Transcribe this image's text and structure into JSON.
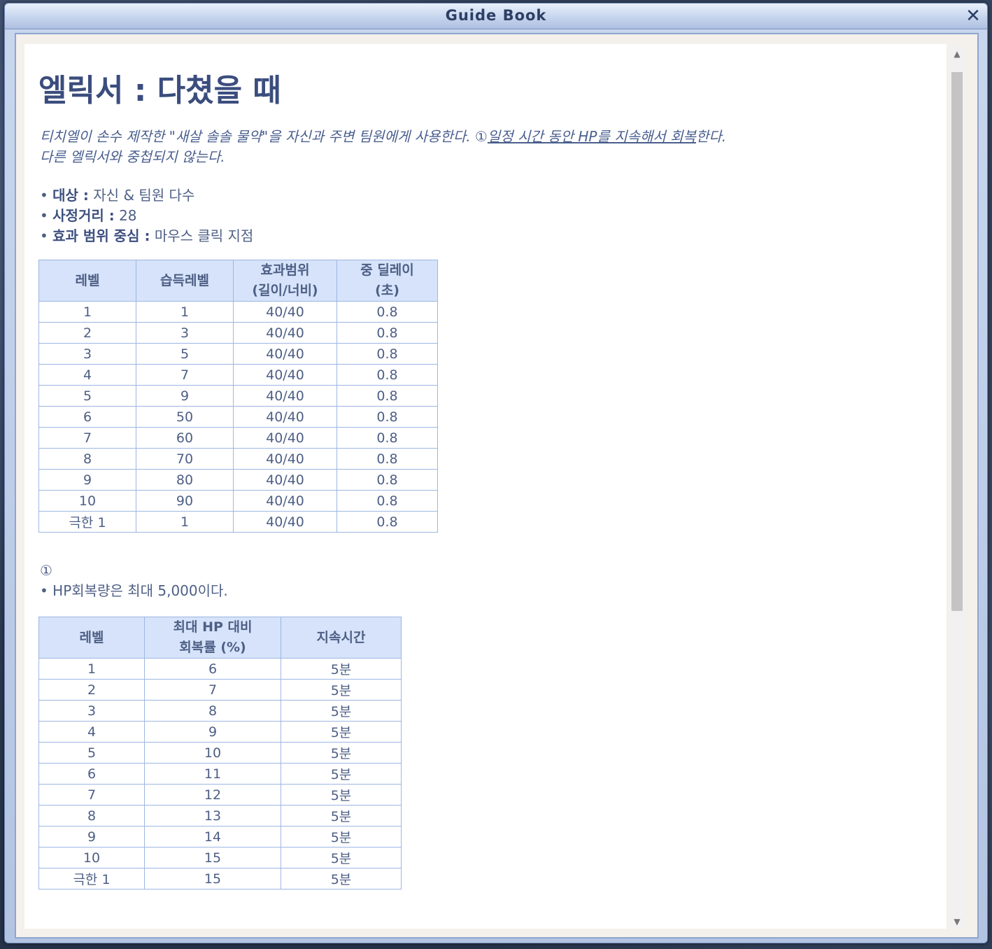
{
  "window": {
    "title": "Guide Book",
    "close_glyph": "✕"
  },
  "skill": {
    "title": "엘릭서 : 다쳤을 때",
    "description_part1": "티치엘이 손수 제작한 \"새살 솔솔 물약\"을 자신과 주변 팀원에게 사용한다. ①",
    "description_underline": "일정 시간 동안 HP를 지속해서 회복",
    "description_part2": "한다.",
    "description_line2": "다른 엘릭서와 중첩되지 않는다.",
    "specs": [
      {
        "label": "대상 :",
        "value": "자신 & 팀원 다수"
      },
      {
        "label": "사정거리 :",
        "value": "28"
      },
      {
        "label": "효과 범위 중심 :",
        "value": "마우스 클릭 지점"
      }
    ]
  },
  "table1": {
    "headers": [
      "레벨",
      "습득레벨",
      "효과범위\n(길이/너비)",
      "중 딜레이\n(초)"
    ],
    "rows": [
      [
        "1",
        "1",
        "40/40",
        "0.8"
      ],
      [
        "2",
        "3",
        "40/40",
        "0.8"
      ],
      [
        "3",
        "5",
        "40/40",
        "0.8"
      ],
      [
        "4",
        "7",
        "40/40",
        "0.8"
      ],
      [
        "5",
        "9",
        "40/40",
        "0.8"
      ],
      [
        "6",
        "50",
        "40/40",
        "0.8"
      ],
      [
        "7",
        "60",
        "40/40",
        "0.8"
      ],
      [
        "8",
        "70",
        "40/40",
        "0.8"
      ],
      [
        "9",
        "80",
        "40/40",
        "0.8"
      ],
      [
        "10",
        "90",
        "40/40",
        "0.8"
      ],
      [
        "극한 1",
        "1",
        "40/40",
        "0.8"
      ]
    ]
  },
  "note": {
    "marker": "①",
    "text": "• HP회복량은 최대 5,000이다."
  },
  "table2": {
    "headers": [
      "레벨",
      "최대 HP 대비\n회복률 (%)",
      "지속시간"
    ],
    "rows": [
      [
        "1",
        "6",
        "5분"
      ],
      [
        "2",
        "7",
        "5분"
      ],
      [
        "3",
        "8",
        "5분"
      ],
      [
        "4",
        "9",
        "5분"
      ],
      [
        "5",
        "10",
        "5분"
      ],
      [
        "6",
        "11",
        "5분"
      ],
      [
        "7",
        "12",
        "5분"
      ],
      [
        "8",
        "13",
        "5분"
      ],
      [
        "9",
        "14",
        "5분"
      ],
      [
        "10",
        "15",
        "5분"
      ],
      [
        "극한 1",
        "15",
        "5분"
      ]
    ]
  },
  "scrollbar": {
    "up_glyph": "▲",
    "down_glyph": "▼"
  }
}
